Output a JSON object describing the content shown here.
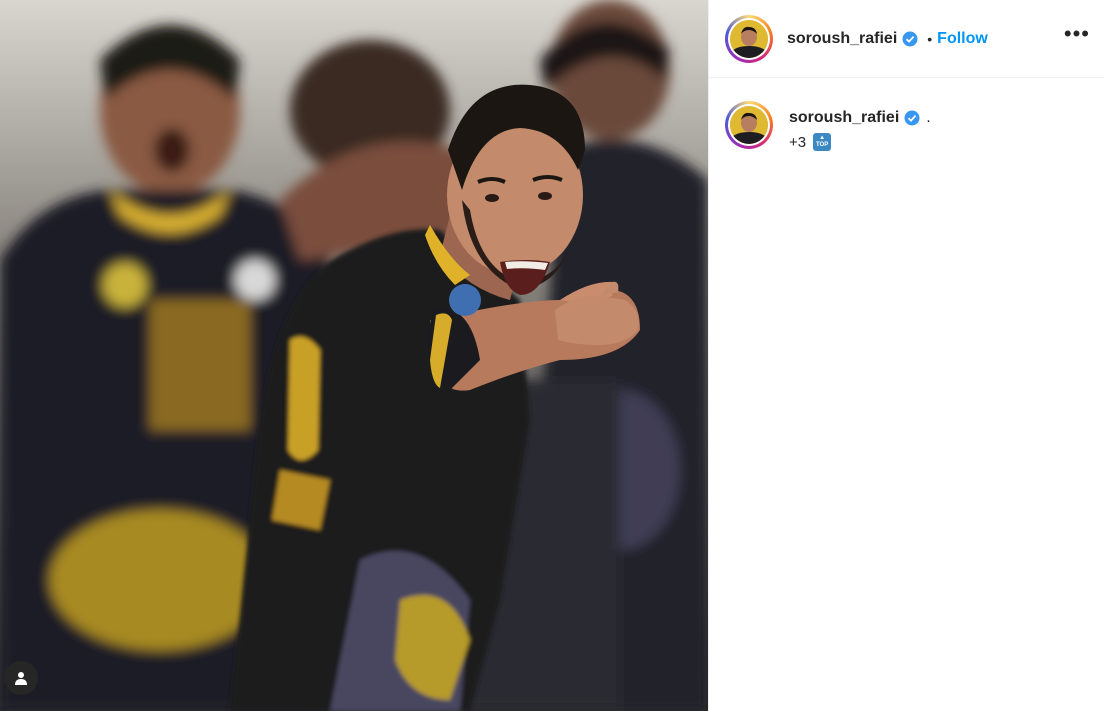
{
  "post": {
    "image_alt": "Footballer in black and yellow kit pointing and shouting, teammates celebrating behind",
    "tagged_icon": "user-icon"
  },
  "header": {
    "username": "soroush_rafiei",
    "verified_icon": "verified-badge-icon",
    "separator": "•",
    "follow_label": "Follow",
    "more_label": "•••"
  },
  "caption": {
    "username": "soroush_rafiei",
    "text": ".",
    "line2": "+3",
    "emoji_label": "TOP",
    "emoji_icon": "top-arrow-emoji"
  },
  "colors": {
    "follow": "#0095f6",
    "verified": "#3897f0",
    "kit_black": "#1b1b20",
    "kit_yellow": "#e8b923"
  }
}
